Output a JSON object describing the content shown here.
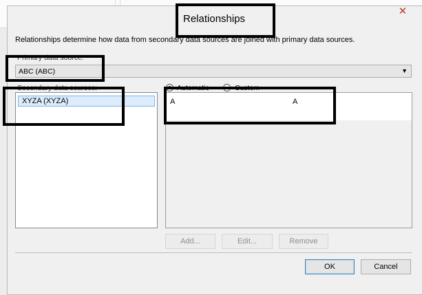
{
  "dialog": {
    "title": "Relationships",
    "close_glyph": "✕",
    "description": "Relationships determine how data from secondary data sources are joined with primary data sources."
  },
  "primary": {
    "label": "Primary data source:",
    "selected": "ABC (ABC)"
  },
  "secondary": {
    "label": "Secondary data sources:",
    "items": [
      "XYZA (XYZA)"
    ]
  },
  "mode": {
    "automatic_label": "Automatic",
    "custom_label": "Custom",
    "selected": "Automatic"
  },
  "fields": {
    "rows": [
      {
        "primary": "A",
        "secondary": "A"
      }
    ]
  },
  "buttons": {
    "add": "Add...",
    "edit": "Edit...",
    "remove": "Remove",
    "ok": "OK",
    "cancel": "Cancel"
  },
  "colors": {
    "selection_fill": "#dcecfc",
    "selection_border": "#7eb4ea",
    "highlight_box": "#000000"
  }
}
